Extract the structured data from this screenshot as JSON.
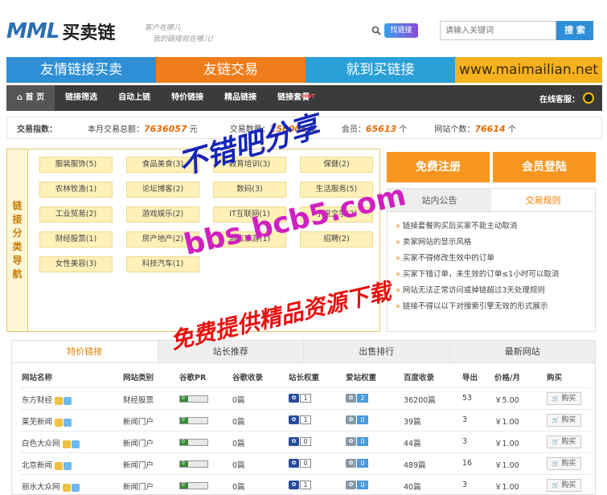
{
  "header": {
    "logo_en": "MML",
    "logo_cn": "买卖链",
    "slogan_line1": "客户在哪儿",
    "slogan_line2": "我的链接就在哪儿!",
    "search_badge": "找链接",
    "search_placeholder": "请输入关键词",
    "search_button": "搜 索"
  },
  "banner": [
    {
      "label": "友情链接买卖",
      "color": "#2e8fd6"
    },
    {
      "label": "友链交易",
      "color": "#f07d1b"
    },
    {
      "label": "就到买链接",
      "color": "#2aa0d8"
    },
    {
      "label": "www.maimailian.net",
      "color": "#f5b21d"
    }
  ],
  "nav": {
    "home": "首 页",
    "items": [
      "链接筛选",
      "自动上链",
      "特价链接",
      "精品链接",
      "链接套餐"
    ],
    "hot_badge": "HOT",
    "service": "在线客服："
  },
  "stats": {
    "index_label": "交易指数：",
    "monthly_total_label": "本月交易总额：",
    "monthly_total_value": "7636057",
    "monthly_total_unit": "元",
    "trade_count_label": "交易数量：",
    "trade_count_value": "256005",
    "trade_count_unit": "笔",
    "member_label": "会员",
    "member_value": "65613",
    "member_unit": "个",
    "site_count_label": "网站个数：",
    "site_count_value": "76614",
    "site_count_unit": "个"
  },
  "categories": {
    "side_label": "链接分类导航",
    "items": [
      "服装服饰(5)",
      "食品美食(3)",
      "教育培训(3)",
      "保健(2)",
      "农林牧渔(1)",
      "论坛博客(2)",
      "数码(3)",
      "生活服务(5)",
      "工业贸易(2)",
      "游戏娱乐(2)",
      "IT互联网(1)",
      "小说文学(2)",
      "财经股票(1)",
      "房产地产(2)",
      "酒店旅游(1)",
      "招聘(2)",
      "女性美容(3)",
      "科技汽车(1)"
    ]
  },
  "actions": {
    "register": "免费注册",
    "login": "会员登陆"
  },
  "notice": {
    "tabs": [
      "站内公告",
      "交易规则"
    ],
    "items": [
      "链接套餐购买后买家不能主动取消",
      "卖家网站的显示风格",
      "买家不得修改生效中的订单",
      "买家下错订单，未生效的订单≤1小时可以取消",
      "网站无法正常访问或掉链超过3天处理规则",
      "链接不得以以下对搜索引擎无效的形式展示"
    ]
  },
  "listing": {
    "tabs": [
      "特价链接",
      "站长推荐",
      "出售排行",
      "最新网站"
    ],
    "columns": [
      "网站名称",
      "网站类别",
      "谷歌PR",
      "谷歌收录",
      "站长权重",
      "爱站权重",
      "百度收录",
      "导出",
      "价格/月",
      "购买"
    ],
    "buy_label": "购买",
    "rows": [
      {
        "name": "东方财经",
        "category": "财经股票",
        "pr": "0",
        "google": "0篇",
        "zz": "1",
        "az": "2",
        "baidu": "36200篇",
        "export": "53",
        "price": "￥5.00"
      },
      {
        "name": "莱芜新闻",
        "category": "新闻门户",
        "pr": "0",
        "google": "0篇",
        "zz": "1",
        "az": "0",
        "baidu": "39篇",
        "export": "3",
        "price": "￥1.00"
      },
      {
        "name": "白色大众网",
        "category": "新闻门户",
        "pr": "0",
        "google": "0篇",
        "zz": "0",
        "az": "0",
        "baidu": "44篇",
        "export": "3",
        "price": "￥1.00"
      },
      {
        "name": "北京新闻",
        "category": "新闻门户",
        "pr": "0",
        "google": "0篇",
        "zz": "0",
        "az": "0",
        "baidu": "489篇",
        "export": "16",
        "price": "￥1.00"
      },
      {
        "name": "丽水大众网",
        "category": "新闻门户",
        "pr": "0",
        "google": "0篇",
        "zz": "1",
        "az": "0",
        "baidu": "40篇",
        "export": "3",
        "price": "￥1.00"
      }
    ]
  },
  "watermark": {
    "line1": "不错吧分享",
    "line2": "bbs.bcb5.com",
    "line3": "免费提供精品资源下载"
  }
}
